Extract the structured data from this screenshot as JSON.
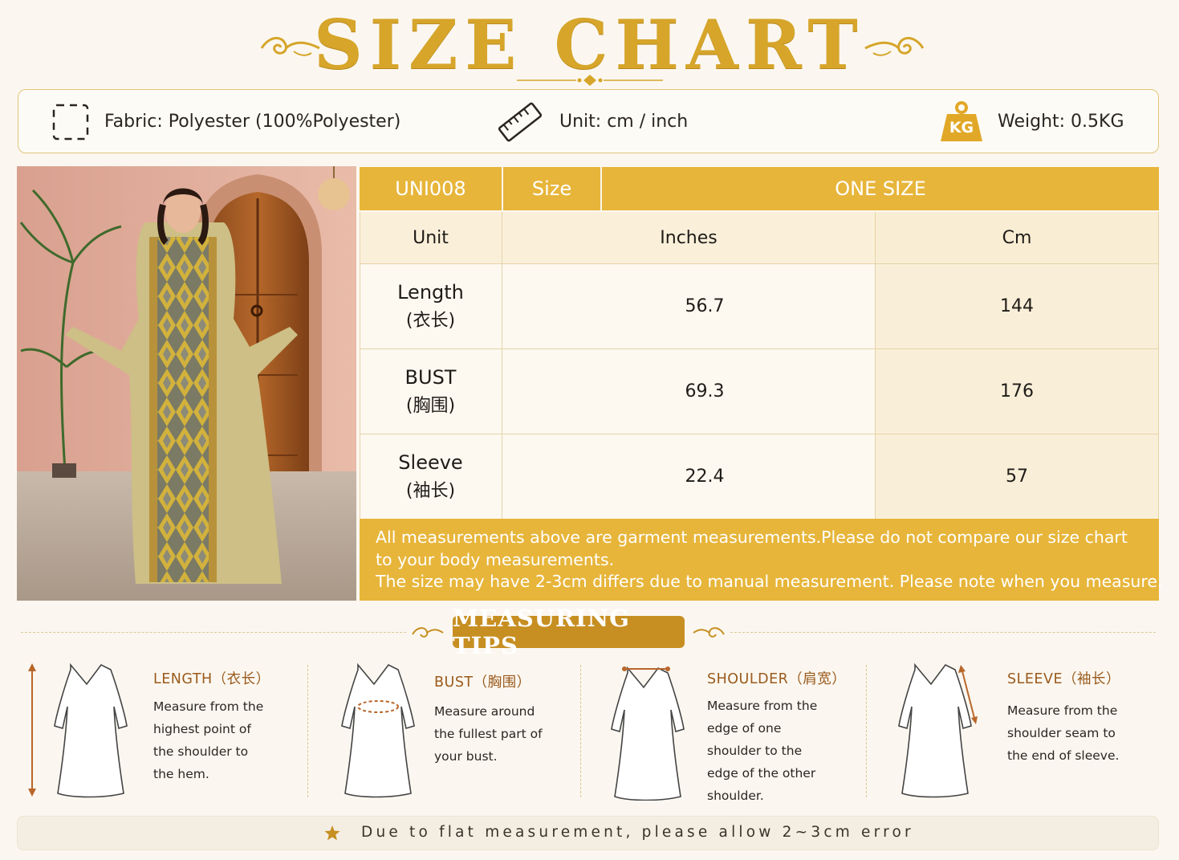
{
  "title": "SIZE CHART",
  "colors": {
    "gold": "#e7b53a",
    "title_gold": "#d6a52a",
    "tips_brown": "#c78f22",
    "tip_title": "#9a5a1c"
  },
  "info": {
    "fabric": "Fabric: Polyester (100%Polyester)",
    "unit": "Unit: cm / inch",
    "weight_badge": "KG",
    "weight": "Weight: 0.5KG",
    "icons": [
      "dashed-square-icon",
      "ruler-icon",
      "weight-icon"
    ]
  },
  "table": {
    "code": "UNI008",
    "size_label": "Size",
    "size_value": "ONE SIZE",
    "unit_label": "Unit",
    "col_inches": "Inches",
    "col_cm": "Cm",
    "rows": [
      {
        "name": "Length",
        "cn": "(衣长)",
        "inches": "56.7",
        "cm": "144"
      },
      {
        "name": "BUST",
        "cn": "(胸围)",
        "inches": "69.3",
        "cm": "176"
      },
      {
        "name": "Sleeve",
        "cn": "(袖长)",
        "inches": "22.4",
        "cm": "57"
      }
    ],
    "note_lines": [
      "All measurements above are garment measurements.Please do not compare our size chart",
      "to your body measurements.",
      "The size may have 2-3cm differs due to manual measurement. Please note when you measure."
    ]
  },
  "tips": {
    "heading": "MEASURING TIPS",
    "items": [
      {
        "title": "LENGTH（衣长）",
        "desc": "Measure from the\nhighest point of\nthe shoulder to\nthe hem."
      },
      {
        "title": "BUST（胸围）",
        "desc": "Measure around\nthe fullest part of\nyour bust."
      },
      {
        "title": "SHOULDER（肩宽）",
        "desc": "Measure from the\nedge of one\nshoulder to the\nedge of the other\nshoulder."
      },
      {
        "title": "SLEEVE（袖长）",
        "desc": "Measure from the\nshoulder seam to\nthe end of sleeve."
      }
    ]
  },
  "footer": {
    "text": "Due to flat measurement, please allow 2~3cm error"
  }
}
